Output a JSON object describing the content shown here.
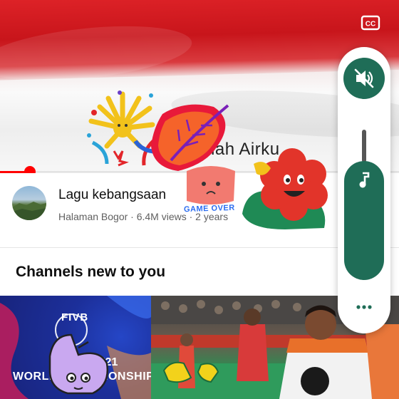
{
  "video": {
    "caption": "nah Airku",
    "progress": 0.075
  },
  "info": {
    "title": "Lagu kebangsaan",
    "meta": "Halaman Bogor · 6.4M views · 2 years"
  },
  "section": {
    "title": "Channels new to you"
  },
  "thumbs": {
    "fivb": "FIVB",
    "wc_line1": "U21",
    "wc_line2": "WORLD CHAMPIONSHIP"
  },
  "stickers": {
    "game_over": "GAME OVER"
  },
  "icons": {
    "cc": "cc-icon",
    "mute": "volume-off-icon",
    "music": "music-note-icon",
    "more": "more-horizontal-icon"
  },
  "colors": {
    "accent_red": "#ff0000",
    "panel_green": "#1f6d57"
  }
}
